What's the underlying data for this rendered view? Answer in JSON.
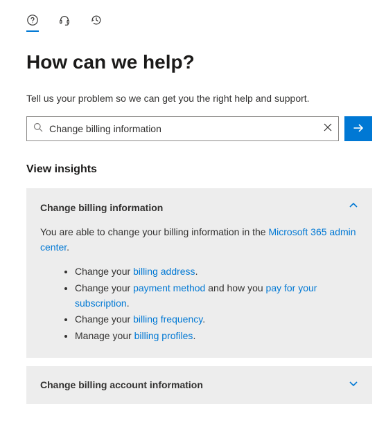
{
  "tabs": [
    {
      "name": "help",
      "active": true
    },
    {
      "name": "headset",
      "active": false
    },
    {
      "name": "history",
      "active": false
    }
  ],
  "title": "How can we help?",
  "subtitle": "Tell us your problem so we can get you the right help and support.",
  "search": {
    "value": "Change billing information",
    "placeholder": "Search"
  },
  "section_heading": "View insights",
  "insights": [
    {
      "title": "Change billing information",
      "expanded": true,
      "intro_prefix": "You are able to change your billing information in the ",
      "intro_link": "Microsoft 365 admin center",
      "intro_suffix": ".",
      "bullets": [
        {
          "prefix": "Change your ",
          "links": [
            {
              "text": "billing address"
            }
          ],
          "mid": "",
          "suffix": "."
        },
        {
          "prefix": "Change your ",
          "links": [
            {
              "text": "payment method"
            },
            {
              "text": "pay for your subscription"
            }
          ],
          "mid": " and how you ",
          "suffix": "."
        },
        {
          "prefix": "Change your ",
          "links": [
            {
              "text": "billing frequency"
            }
          ],
          "mid": "",
          "suffix": "."
        },
        {
          "prefix": "Manage your ",
          "links": [
            {
              "text": "billing profiles"
            }
          ],
          "mid": "",
          "suffix": "."
        }
      ]
    },
    {
      "title": "Change billing account information",
      "expanded": false
    }
  ]
}
